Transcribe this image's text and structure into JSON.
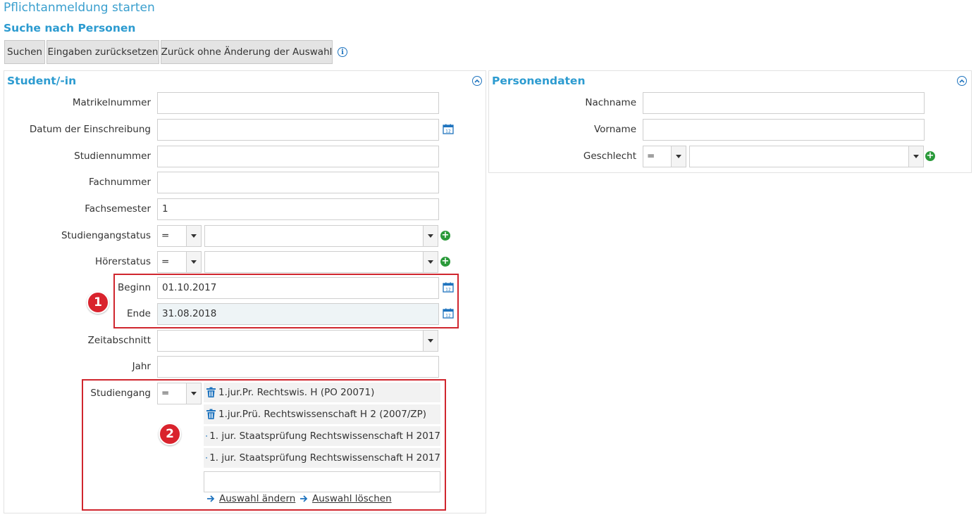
{
  "page": {
    "title": "Pflichtanmeldung starten",
    "section_title": "Suche nach Personen"
  },
  "toolbar": {
    "search_label": "Suchen",
    "reset_label": "Eingaben zurücksetzen",
    "back_label": "Zurück ohne Änderung der Auswahl"
  },
  "student_panel": {
    "title": "Student/-in",
    "fields": {
      "matrikelnummer": {
        "label": "Matrikelnummer",
        "value": ""
      },
      "einschreibung": {
        "label": "Datum der Einschreibung",
        "value": ""
      },
      "studiennummer": {
        "label": "Studiennummer",
        "value": ""
      },
      "fachnummer": {
        "label": "Fachnummer",
        "value": ""
      },
      "fachsemester": {
        "label": "Fachsemester",
        "value": "1"
      },
      "studiengangstatus": {
        "label": "Studiengangstatus",
        "operator": "=",
        "value": ""
      },
      "hoererstatus": {
        "label": "Hörerstatus",
        "operator": "=",
        "value": ""
      },
      "beginn": {
        "label": "Beginn",
        "value": "01.10.2017"
      },
      "ende": {
        "label": "Ende",
        "value": "31.08.2018"
      },
      "zeitabschnitt": {
        "label": "Zeitabschnitt",
        "value": ""
      },
      "jahr": {
        "label": "Jahr",
        "value": ""
      },
      "studiengang": {
        "label": "Studiengang",
        "operator": "=",
        "items": [
          "1.jur.Pr. Rechtswis. H (PO 20071)",
          "1.jur.Prü. Rechtswissenschaft H 2 (2007/ZP)",
          "1. jur. Staatsprüfung Rechtswissenschaft H 2017",
          "1. jur. Staatsprüfung Rechtswissenschaft H 2017"
        ],
        "input_value": "",
        "change_link": "Auswahl ändern",
        "delete_link": "Auswahl löschen"
      }
    }
  },
  "person_panel": {
    "title": "Personendaten",
    "fields": {
      "nachname": {
        "label": "Nachname",
        "value": ""
      },
      "vorname": {
        "label": "Vorname",
        "value": ""
      },
      "geschlecht": {
        "label": "Geschlecht",
        "operator": "=",
        "value": ""
      }
    }
  },
  "annotations": {
    "badge1": "1",
    "badge2": "2",
    "highlight_color": "#d0262e"
  },
  "colors": {
    "accent": "#2c9bd0",
    "icon_blue": "#1e73be",
    "add_green": "#2a9a3a"
  }
}
